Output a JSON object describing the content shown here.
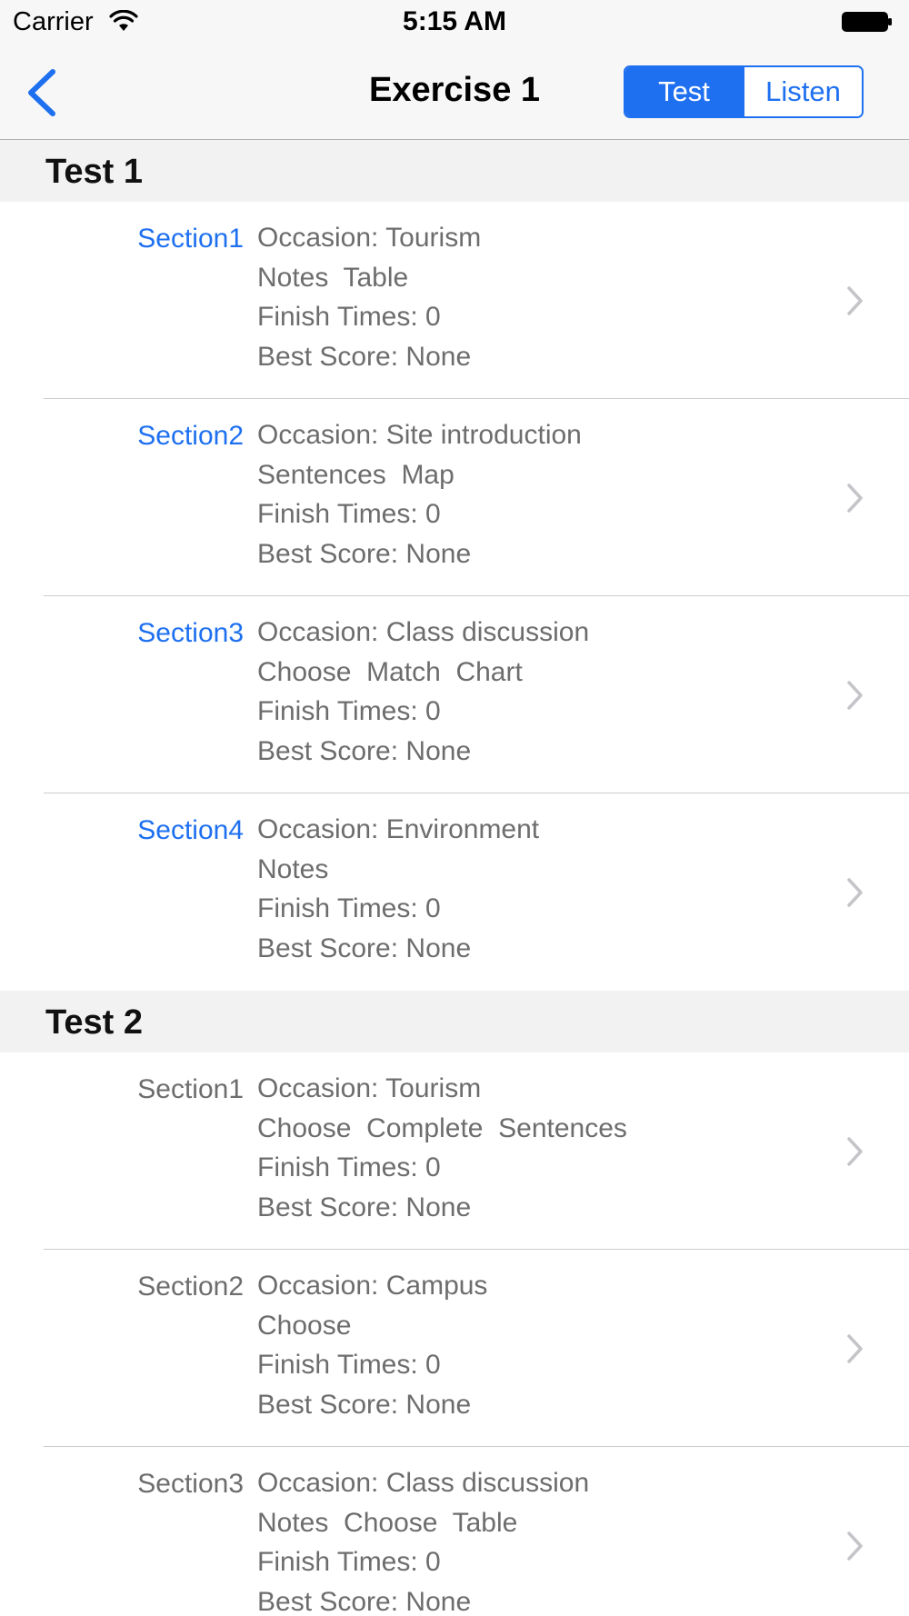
{
  "status_bar": {
    "carrier": "Carrier",
    "time": "5:15 AM",
    "wifi_icon": "wifi-icon",
    "battery_icon": "battery-icon"
  },
  "nav": {
    "title": "Exercise 1",
    "back_icon": "chevron-left-icon",
    "segments": [
      {
        "label": "Test",
        "selected": true
      },
      {
        "label": "Listen",
        "selected": false
      }
    ]
  },
  "colors": {
    "accent": "#1e70f0",
    "detail_text": "#6d6d6d",
    "header_bg": "#f2f2f2",
    "bar_bg": "#f7f7f7"
  },
  "tests": [
    {
      "title": "Test 1",
      "sections": [
        {
          "label": "Section1",
          "highlighted": true,
          "occasion": "Occasion: Tourism",
          "types": "Notes  Table",
          "finish": "Finish Times: 0",
          "score": "Best Score: None"
        },
        {
          "label": "Section2",
          "highlighted": true,
          "occasion": "Occasion: Site introduction",
          "types": "Sentences  Map",
          "finish": "Finish Times: 0",
          "score": "Best Score: None"
        },
        {
          "label": "Section3",
          "highlighted": true,
          "occasion": "Occasion: Class discussion",
          "types": "Choose  Match  Chart",
          "finish": "Finish Times: 0",
          "score": "Best Score: None"
        },
        {
          "label": "Section4",
          "highlighted": true,
          "occasion": "Occasion: Environment",
          "types": "Notes",
          "finish": "Finish Times: 0",
          "score": "Best Score: None"
        }
      ]
    },
    {
      "title": "Test 2",
      "sections": [
        {
          "label": "Section1",
          "highlighted": false,
          "occasion": "Occasion: Tourism",
          "types": "Choose  Complete  Sentences",
          "finish": "Finish Times: 0",
          "score": "Best Score: None"
        },
        {
          "label": "Section2",
          "highlighted": false,
          "occasion": "Occasion: Campus",
          "types": "Choose",
          "finish": "Finish Times: 0",
          "score": "Best Score: None"
        },
        {
          "label": "Section3",
          "highlighted": false,
          "occasion": "Occasion: Class discussion",
          "types": "Notes  Choose  Table",
          "finish": "Finish Times: 0",
          "score": "Best Score: None"
        }
      ]
    }
  ]
}
